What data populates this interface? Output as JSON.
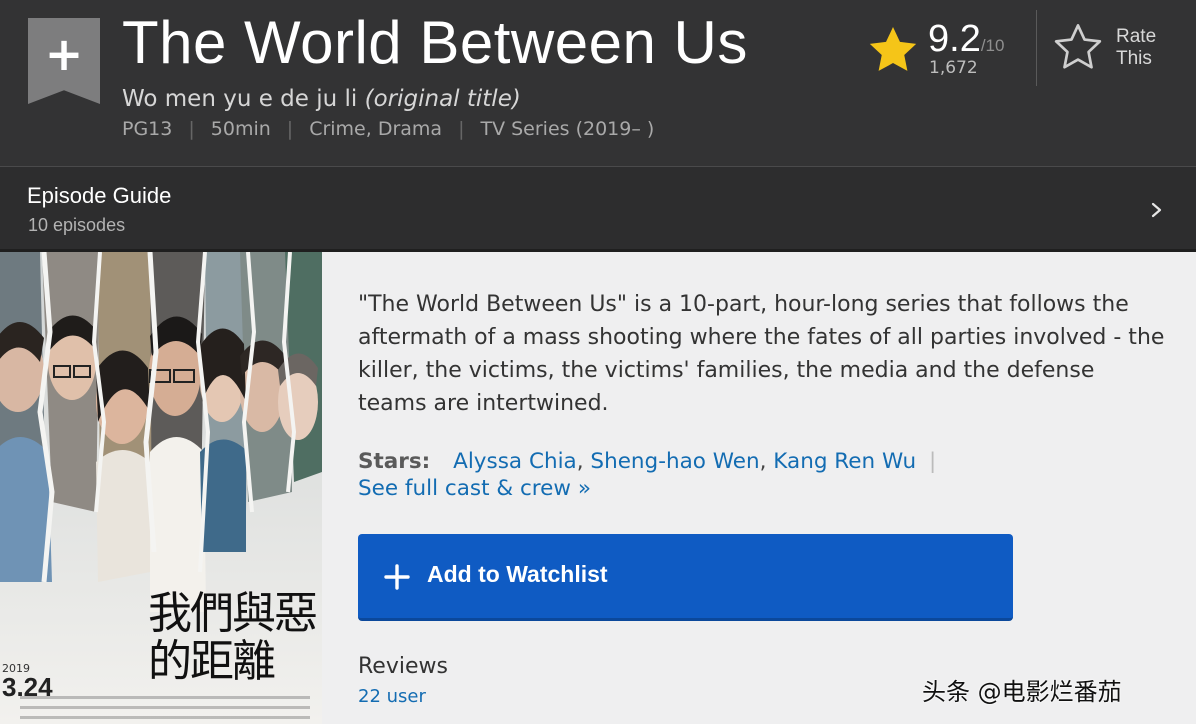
{
  "header": {
    "title": "The World Between Us",
    "original_title": "Wo men yu e de ju li",
    "original_title_suffix": "(original title)",
    "meta": {
      "rating": "PG13",
      "runtime": "50min",
      "genres": "Crime, Drama",
      "type": "TV Series (2019– )"
    },
    "separator": "|"
  },
  "rating": {
    "value": "9.2",
    "max": "/10",
    "count": "1,672",
    "star_color": "#f5c518"
  },
  "rate_this": {
    "line1": "Rate",
    "line2": "This",
    "icon": "star-outline-icon"
  },
  "episode_guide": {
    "title": "Episode Guide",
    "count": "10 episodes",
    "icon": "chevron-right-icon"
  },
  "poster": {
    "title_cn": "我們與惡的距離",
    "date": "3.24",
    "year": "2019"
  },
  "main": {
    "plot": "\"The World Between Us\" is a 10-part, hour-long series that follows the aftermath of a mass shooting where the fates of all parties involved - the killer, the victims, the victims' families, the media and the defense teams are intertwined.",
    "stars_label": "Stars:",
    "stars": [
      "Alyssa Chia",
      "Sheng-hao Wen",
      "Kang Ren Wu"
    ],
    "star_separator": ",",
    "pipe": "|",
    "full_cast": "See full cast & crew",
    "full_cast_arrow": "»",
    "watchlist_label": "Add to Watchlist",
    "watchlist_color": "#0f5bc3",
    "reviews_title": "Reviews",
    "reviews_count": "22 user"
  },
  "watermark": "头条 @电影烂番茄",
  "colors": {
    "header_bg": "#333334",
    "link": "#136cb2",
    "accent": "#f5c518"
  }
}
